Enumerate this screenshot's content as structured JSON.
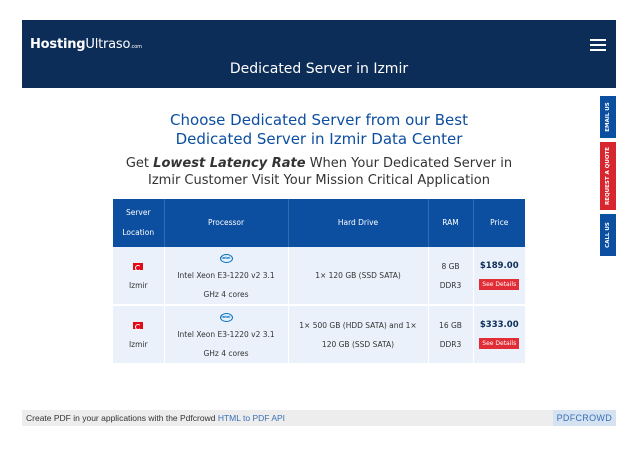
{
  "header": {
    "logo_bold": "Hosting",
    "logo_thin": "Ultraso",
    "logo_small": ".com",
    "title": "Dedicated Server in Izmir",
    "menu_icon": "hamburger-icon",
    "background_color": "#0c2d57"
  },
  "side_tabs": [
    {
      "label": "EMAIL US",
      "color": "#0c4ea0"
    },
    {
      "label": "REQUEST A QUOTE",
      "color": "#d8262f"
    },
    {
      "label": "CALL US",
      "color": "#0c4ea0"
    }
  ],
  "heading": {
    "line1": "Choose Dedicated Server from our Best",
    "line2": "Dedicated Server in Izmir Data Center"
  },
  "subheading": {
    "prefix": "Get ",
    "emphasis": "Lowest Latency Rate",
    "suffix": " When Your Dedicated Server in",
    "line2": "Izmir Customer Visit Your Mission Critical Application"
  },
  "table": {
    "headers": {
      "location_line1": "Server",
      "location_line2": "Location",
      "processor": "Processor",
      "hard_drive": "Hard Drive",
      "ram": "RAM",
      "price": "Price"
    },
    "rows": [
      {
        "location": "Izmir",
        "processor_line1": "Intel Xeon E3-1220 v2 3.1",
        "processor_line2": "GHz 4 cores",
        "hard_drive_line1": "1× 120 GB (SSD SATA)",
        "hard_drive_line2": "",
        "ram_line1": "8 GB",
        "ram_line2": "DDR3",
        "price": "$189.00",
        "button": "See Details"
      },
      {
        "location": "Izmir",
        "processor_line1": "Intel Xeon E3-1220 v2 3.1",
        "processor_line2": "GHz 4 cores",
        "hard_drive_line1": "1× 500 GB (HDD SATA) and 1×",
        "hard_drive_line2": "120 GB (SSD SATA)",
        "ram_line1": "16 GB",
        "ram_line2": "DDR3",
        "price": "$333.00",
        "button": "See Details"
      }
    ],
    "intel_label": "intel",
    "accent_color": "#0c4ea0",
    "button_color": "#e12d36"
  },
  "footer": {
    "text": "Create PDF in your applications with the Pdfcrowd ",
    "link": "HTML to PDF API",
    "brand": "PDFCROWD"
  }
}
